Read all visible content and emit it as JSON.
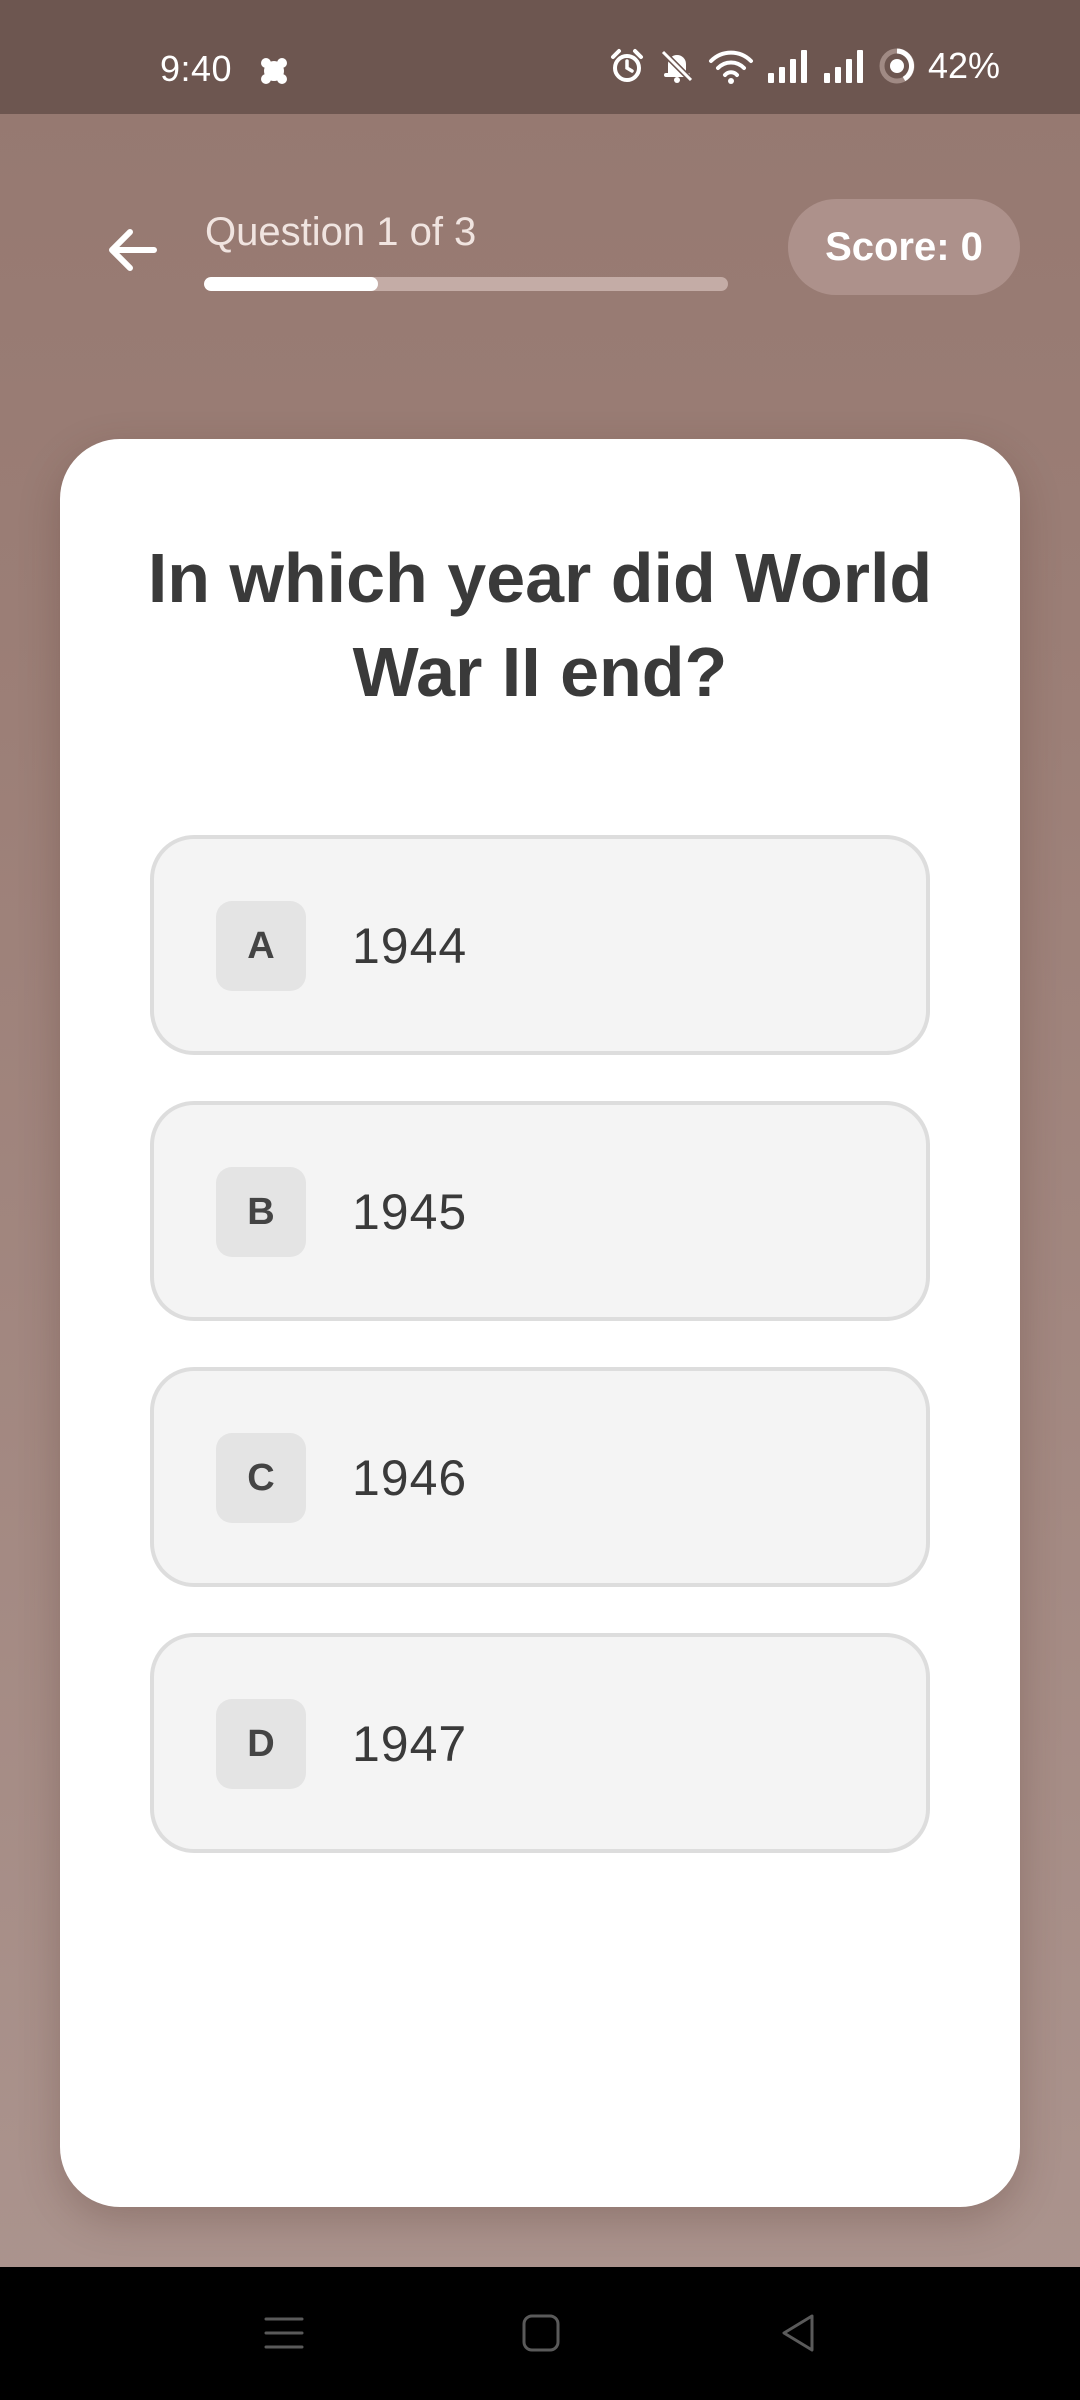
{
  "status_bar": {
    "time": "9:40",
    "battery": "42%",
    "icons": [
      "notification-app-icon",
      "alarm-icon",
      "bell-off-icon",
      "wifi-icon",
      "signal-icon",
      "signal-icon",
      "battery-ring-icon"
    ]
  },
  "header": {
    "back_icon": "arrow-left-icon",
    "progress_label": "Question 1 of 3",
    "progress": 0.333,
    "score_label": "Score: 0"
  },
  "question": {
    "text": "In which year did World War II end?"
  },
  "options": [
    {
      "letter": "A",
      "text": "1944"
    },
    {
      "letter": "B",
      "text": "1945"
    },
    {
      "letter": "C",
      "text": "1946"
    },
    {
      "letter": "D",
      "text": "1947"
    }
  ],
  "nav_bar": {
    "icons": [
      "menu-lines-icon",
      "home-square-icon",
      "back-triangle-icon"
    ]
  },
  "colors": {
    "background": "#9c7f77",
    "status_bar": "#6d5650",
    "card": "#ffffff",
    "option_bg": "#f4f4f4",
    "option_border": "#dddddd",
    "text": "#3a3a3a"
  }
}
